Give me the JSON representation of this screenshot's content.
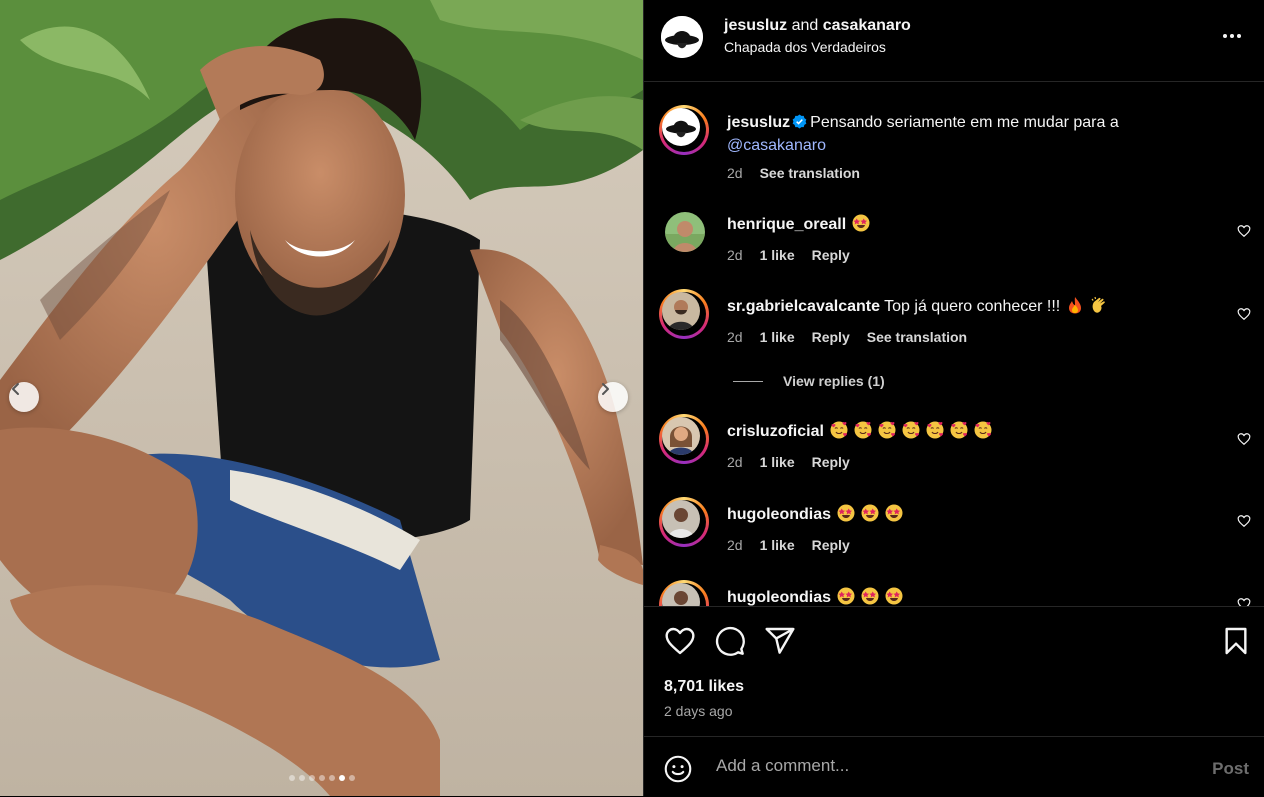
{
  "header": {
    "user1": "jesusluz",
    "and_text": "and",
    "user2": "casakanaro",
    "location": "Chapada dos Verdadeiros",
    "more_icon": "more-horizontal-icon"
  },
  "caption": {
    "username": "jesusluz",
    "text": "Pensando seriamente em me mudar para a",
    "mention": "@casakanaro",
    "time": "2d",
    "translate": "See translation"
  },
  "comments": [
    {
      "username": "henrique_oreall",
      "text": "",
      "emoji": [
        "star-struck"
      ],
      "time": "2d",
      "likes": "1 like",
      "reply": "Reply"
    },
    {
      "username": "sr.gabrielcavalcante",
      "text": "Top já quero conhecer !!!",
      "emoji": [
        "fire",
        "clapping-hands"
      ],
      "time": "2d",
      "likes": "1 like",
      "reply": "Reply",
      "translate": "See translation",
      "view_replies": "View replies (1)"
    },
    {
      "username": "crisluzoficial",
      "text": "",
      "emoji": [
        "smiling-hearts",
        "smiling-hearts",
        "smiling-hearts",
        "smiling-hearts",
        "smiling-hearts",
        "smiling-hearts",
        "smiling-hearts"
      ],
      "time": "2d",
      "likes": "1 like",
      "reply": "Reply"
    },
    {
      "username": "hugoleondias",
      "text": "",
      "emoji": [
        "star-struck",
        "star-struck",
        "star-struck"
      ],
      "time": "2d",
      "likes": "1 like",
      "reply": "Reply"
    },
    {
      "username": "hugoleondias",
      "text": "",
      "emoji": [
        "star-struck",
        "star-struck",
        "star-struck"
      ]
    }
  ],
  "stats": {
    "likes": "8,701 likes",
    "time_ago": "2 days ago"
  },
  "composer": {
    "placeholder": "Add a comment...",
    "post_label": "Post"
  },
  "carousel": {
    "total": 7,
    "active_index": 5
  },
  "colors": {
    "background": "#000000",
    "text": "#f5f5f5",
    "muted": "#a8a8a8",
    "mention": "#a0b8ff",
    "verified": "#0095f6",
    "divider": "#262626"
  }
}
